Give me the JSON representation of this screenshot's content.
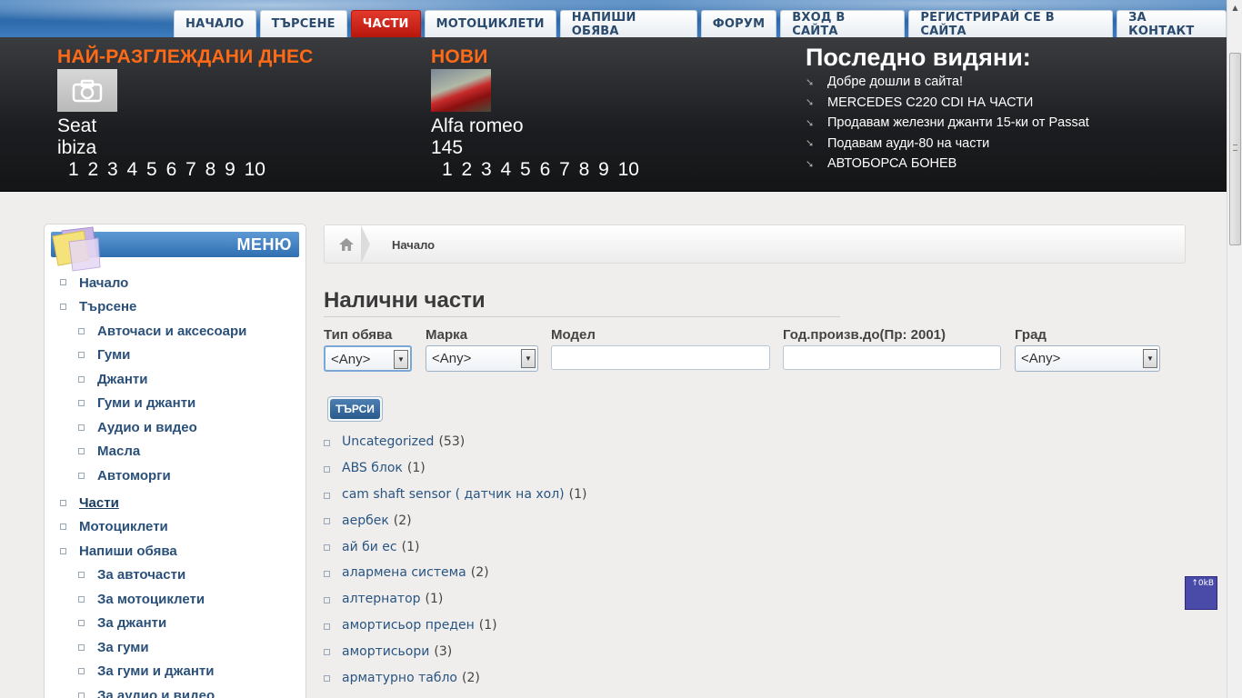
{
  "nav": [
    {
      "label": "НАЧАЛО",
      "active": false
    },
    {
      "label": "ТЪРСЕНЕ",
      "active": false
    },
    {
      "label": "ЧАСТИ",
      "active": true
    },
    {
      "label": "МОТОЦИКЛЕТИ",
      "active": false
    },
    {
      "label": "НАПИШИ ОБЯВА",
      "active": false
    },
    {
      "label": "ФОРУМ",
      "active": false
    },
    {
      "label": "ВХОД В САЙТА",
      "active": false
    },
    {
      "label": "РЕГИСТРИРАЙ СЕ В САЙТА",
      "active": false
    },
    {
      "label": "ЗА КОНТАКТ",
      "active": false
    }
  ],
  "header": {
    "most_viewed": {
      "title": "НАЙ-РАЗГЛЕЖДАНИ ДНЕС",
      "name_line1": "Seat",
      "name_line2": "ibiza",
      "pages": "1 2 3 4 5 6 7 8 9 10"
    },
    "newest": {
      "title": "НОВИ",
      "name_line1": "Alfa romeo",
      "name_line2": "145",
      "pages": "1 2 3 4 5 6 7 8 9 10"
    },
    "recently_seen": {
      "title": "Последно видяни:",
      "items": [
        "Добре дошли в сайта!",
        "MERCEDES C220 CDI НА ЧАСТИ",
        "Продавам железни джанти 15-ки от Passat",
        "Подавам ауди-80 на части",
        "АВТОБОРСА БОНЕВ"
      ]
    }
  },
  "menu": {
    "title": "МЕНЮ",
    "items": [
      {
        "label": "Начало",
        "level": 1,
        "active": false
      },
      {
        "label": "Търсене",
        "level": 1,
        "active": false
      },
      {
        "label": "Авточаси и аксесоари",
        "level": 2,
        "active": false
      },
      {
        "label": "Гуми",
        "level": 2,
        "active": false
      },
      {
        "label": "Джанти",
        "level": 2,
        "active": false
      },
      {
        "label": "Гуми и джанти",
        "level": 2,
        "active": false
      },
      {
        "label": "Аудио и видео",
        "level": 2,
        "active": false
      },
      {
        "label": "Масла",
        "level": 2,
        "active": false
      },
      {
        "label": "Автоморги",
        "level": 2,
        "active": false
      },
      {
        "label": "Части",
        "level": 1,
        "active": true
      },
      {
        "label": "Мотоциклети",
        "level": 1,
        "active": false
      },
      {
        "label": "Напиши обява",
        "level": 1,
        "active": false
      },
      {
        "label": "За авточасти",
        "level": 2,
        "active": false
      },
      {
        "label": "За мотоциклети",
        "level": 2,
        "active": false
      },
      {
        "label": "За джанти",
        "level": 2,
        "active": false
      },
      {
        "label": "За гуми",
        "level": 2,
        "active": false
      },
      {
        "label": "За гуми и джанти",
        "level": 2,
        "active": false
      },
      {
        "label": "За аудио и видео",
        "level": 2,
        "active": false
      }
    ]
  },
  "breadcrumb": {
    "current": "Начало"
  },
  "page_title": "Налични части",
  "filters": {
    "type": {
      "label": "Тип обява",
      "value": "<Any>"
    },
    "brand": {
      "label": "Марка",
      "value": "<Any>"
    },
    "model": {
      "label": "Модел",
      "value": ""
    },
    "year": {
      "label": "Год.произв.до(Пр: 2001)",
      "value": ""
    },
    "city": {
      "label": "Град",
      "value": "<Any>"
    }
  },
  "search_button": "ТЪРСИ",
  "categories": [
    {
      "name": "Uncategorized",
      "count": "(53)"
    },
    {
      "name": "ABS блок",
      "count": "(1)"
    },
    {
      "name": "cam shaft sensor ( датчик на хол)",
      "count": "(1)"
    },
    {
      "name": "аербек",
      "count": "(2)"
    },
    {
      "name": "ай би ес",
      "count": "(1)"
    },
    {
      "name": "алармена система",
      "count": "(2)"
    },
    {
      "name": "алтернатор",
      "count": "(1)"
    },
    {
      "name": "амортисьор преден",
      "count": "(1)"
    },
    {
      "name": "амортисьори",
      "count": "(3)"
    },
    {
      "name": "арматурно табло",
      "count": "(2)"
    }
  ],
  "widget_label": "↑0kB"
}
